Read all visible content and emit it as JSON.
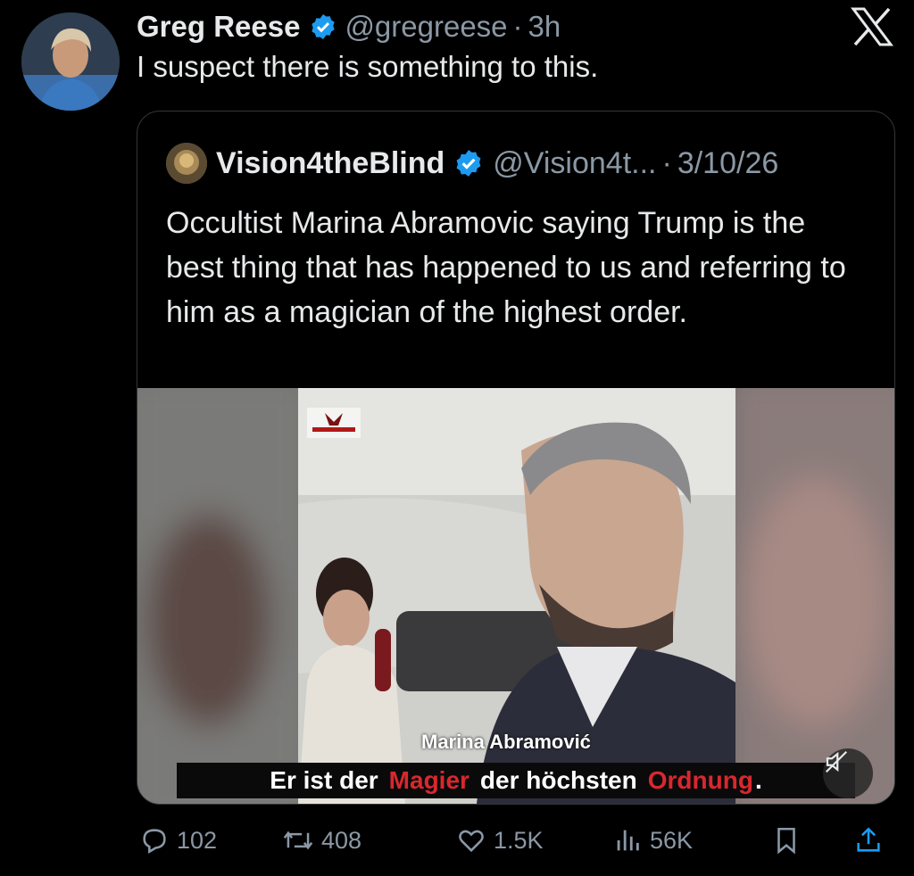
{
  "tweet": {
    "author_name": "Greg Reese",
    "author_handle": "@gregreese",
    "separator": "·",
    "time": "3h",
    "text": "I suspect there is something to this."
  },
  "quoted_tweet": {
    "author_name": "Vision4theBlind",
    "author_handle": "@Vision4t...",
    "separator": "·",
    "date": "3/10/26",
    "text": "Occultist Marina Abramovic saying Trump is the best thing that has happened to us and referring to him as a magician of the highest order.",
    "video": {
      "name_caption": "Marina Abramović",
      "subtitle": {
        "w1": "Er ist der",
        "r1": "Magier",
        "w2": "der höchsten",
        "r2": "Ordnung",
        "end": "."
      },
      "muted": true
    }
  },
  "actions": {
    "replies": "102",
    "reposts": "408",
    "likes": "1.5K",
    "views": "56K"
  },
  "colors": {
    "background": "#000000",
    "text": "#e7e9ea",
    "secondary": "#8b98a5",
    "verified": "#1d9bf0",
    "border": "#333639",
    "subtitle_red": "#d9272e"
  },
  "icons": [
    "x-logo-icon",
    "verified-icon",
    "reply-icon",
    "repost-icon",
    "like-icon",
    "views-icon",
    "bookmark-icon",
    "share-icon",
    "mute-icon"
  ]
}
